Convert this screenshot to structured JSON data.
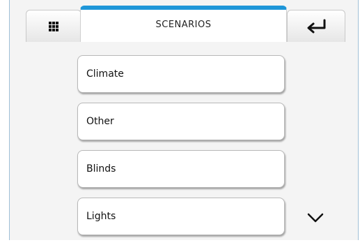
{
  "header": {
    "title": "SCENARIOS",
    "left_icon": "grid-menu-icon",
    "right_icon": "return-arrow-icon",
    "accent_color": "#1e96d8"
  },
  "list": {
    "items": [
      {
        "label": "Climate"
      },
      {
        "label": "Other"
      },
      {
        "label": "Blinds"
      },
      {
        "label": "Lights"
      }
    ]
  },
  "scroll": {
    "icon": "chevron-down-icon"
  }
}
